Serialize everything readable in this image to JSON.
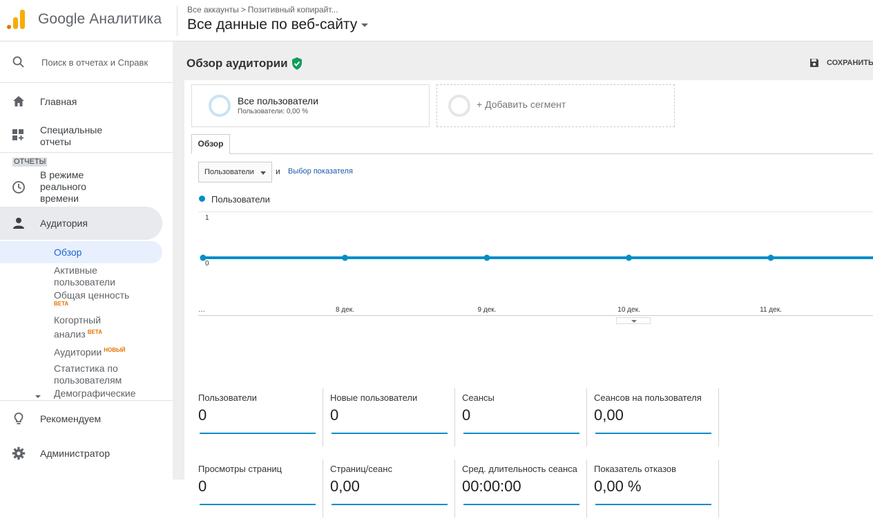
{
  "header": {
    "logo_text": "Google Аналитика",
    "breadcrumb": [
      "Все аккаунты",
      "Позитивный копирайт..."
    ],
    "view_title": "Все данные по веб-сайту"
  },
  "sidebar": {
    "search_placeholder": "Поиск в отчетах и Справк",
    "home": "Главная",
    "custom_reports_l1": "Специальные",
    "custom_reports_l2": "отчеты",
    "section_reports": "ОТЧЕТЫ",
    "realtime_l1": "В режиме",
    "realtime_l2": "реального",
    "realtime_l3": "времени",
    "audience": "Аудитория",
    "sub": {
      "overview": "Обзор",
      "active_l1": "Активные",
      "active_l2": "пользователи",
      "lifetime": "Общая ценность",
      "lifetime_badge": "BETA",
      "cohort_l1": "Когортный",
      "cohort_l2": "анализ",
      "cohort_badge": "BETA",
      "audiences": "Аудитории",
      "audiences_badge": "НОВЫЙ",
      "user_explorer_l1": "Статистика по",
      "user_explorer_l2": "пользователям",
      "demographics": "Демографические"
    },
    "recommend": "Рекомендуем",
    "admin": "Администратор"
  },
  "main": {
    "title": "Обзор аудитории",
    "save": "СОХРАНИТЬ",
    "segment_all": "Все пользователи",
    "segment_all_sub": "Пользователи: 0,00 %",
    "segment_add": "+ Добавить сегмент",
    "tab_overview": "Обзор",
    "metric_select": "Пользователи",
    "and": "и",
    "pick_metric": "Выбор показателя"
  },
  "chart_data": {
    "type": "line",
    "series": [
      {
        "name": "Пользователи",
        "values": [
          0,
          0,
          0,
          0,
          0,
          0
        ]
      }
    ],
    "x": [
      "…",
      "8 дек.",
      "9 дек.",
      "10 дек.",
      "11 дек.",
      ""
    ],
    "y_ticks": [
      "1",
      "0"
    ],
    "ylim": [
      0,
      1
    ],
    "color": "#058dc7"
  },
  "stats": [
    {
      "name": "Пользователи",
      "value": "0"
    },
    {
      "name": "Новые пользователи",
      "value": "0"
    },
    {
      "name": "Сеансы",
      "value": "0"
    },
    {
      "name": "Сеансов на пользователя",
      "value": "0,00"
    },
    {
      "name": "Просмотры страниц",
      "value": "0"
    },
    {
      "name": "Страниц/сеанс",
      "value": "0,00"
    },
    {
      "name": "Сред. длительность сеанса",
      "value": "00:00:00"
    },
    {
      "name": "Показатель отказов",
      "value": "0,00 %"
    }
  ]
}
